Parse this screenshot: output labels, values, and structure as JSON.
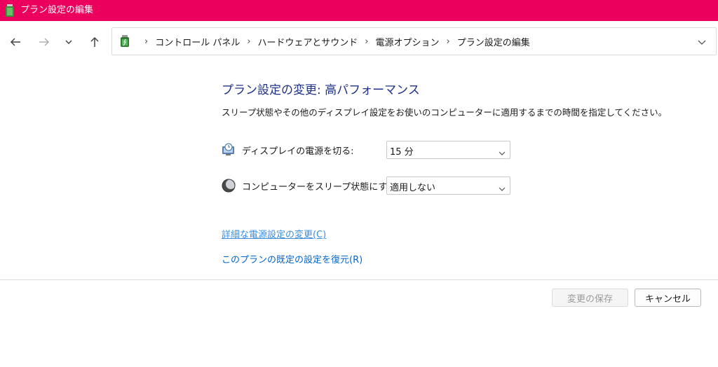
{
  "window": {
    "title": "プラン設定の編集"
  },
  "nav": {
    "breadcrumbs": [
      "コントロール パネル",
      "ハードウェアとサウンド",
      "電源オプション",
      "プラン設定の編集"
    ]
  },
  "main": {
    "heading": "プラン設定の変更: 高パフォーマンス",
    "description": "スリープ状態やその他のディスプレイ設定をお使いのコンピューターに適用するまでの時間を指定してください。",
    "display_off": {
      "label": "ディスプレイの電源を切る:",
      "value": "15 分"
    },
    "sleep": {
      "label": "コンピューターをスリープ状態にする:",
      "value": "適用しない"
    },
    "advanced_link": "詳細な電源設定の変更(C)",
    "restore_link": "このプランの既定の設定を復元(R)"
  },
  "footer": {
    "save_label": "変更の保存",
    "cancel_label": "キャンセル"
  },
  "colors": {
    "titlebar": "#eb005e",
    "heading": "#1e3287",
    "link": "#0066cc"
  }
}
